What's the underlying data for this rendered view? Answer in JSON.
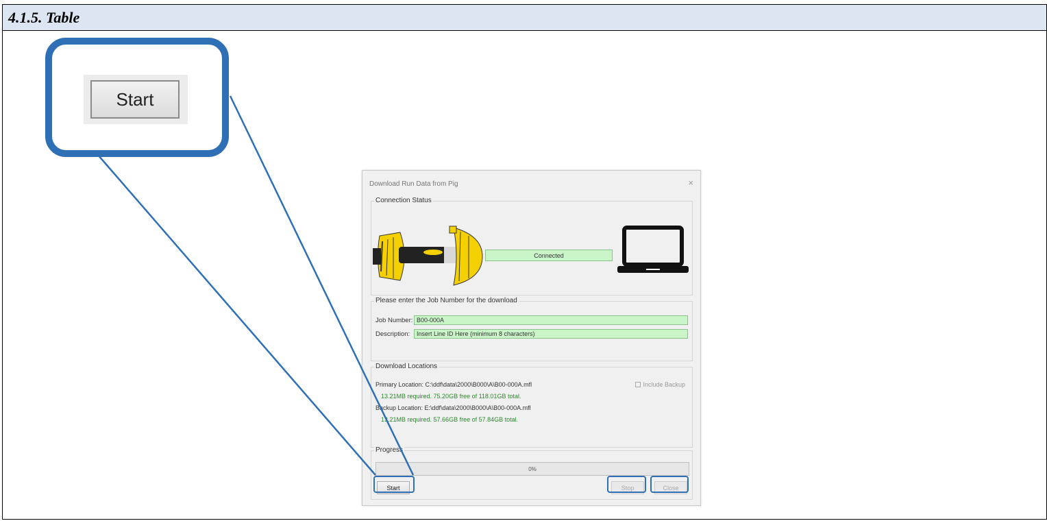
{
  "section": {
    "title": "4.1.5. Table"
  },
  "zoom": {
    "button_label": "Start"
  },
  "dialog": {
    "title": "Download Run Data from Pig",
    "close": "×",
    "connection": {
      "group_label": "Connection Status",
      "status": "Connected"
    },
    "job": {
      "group_label": "Please enter the Job Number for the download",
      "job_number_label": "Job Number:",
      "job_number_value": "B00-000A",
      "description_label": "Description:",
      "description_value": "Insert Line ID Here (minimum 8 characters)"
    },
    "locations": {
      "group_label": "Download Locations",
      "primary": "Primary Location:  C:\\ddf\\data\\2000\\B000\\A\\B00-000A.mfl",
      "primary_space": "13.21MB required. 75.20GB free of 118.01GB total.",
      "backup": "Backup Location:  E:\\ddf\\data\\2000\\B000\\A\\B00-000A.mfl",
      "backup_space": "13.21MB required. 57.66GB free of 57.84GB total.",
      "include_backup": "Include Backup"
    },
    "progress": {
      "group_label": "Progress",
      "percent_text": "0%",
      "value": 0
    },
    "buttons": {
      "start": "Start",
      "stop": "Stop",
      "close": "Close"
    }
  },
  "colors": {
    "header_bg": "#dce6f2",
    "callout": "#2e6fb5",
    "field_green": "#c9f5c9",
    "pig_yellow": "#f5d000"
  },
  "icons": [
    "pig-device-icon",
    "laptop-icon",
    "checkbox-icon"
  ]
}
